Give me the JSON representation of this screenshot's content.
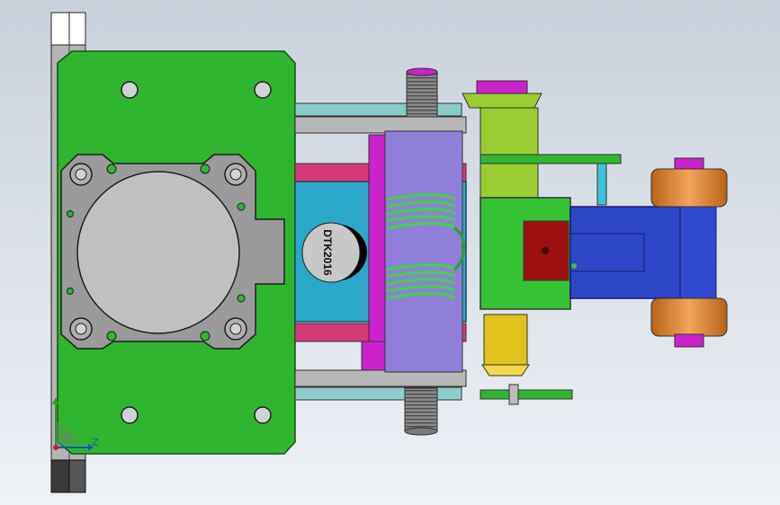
{
  "viewport": {
    "background_top": "#c9d1dc",
    "background_bottom": "#eef1f5"
  },
  "part_label": {
    "text": "DTK2016"
  },
  "triad": {
    "z_label": "Z"
  },
  "colors": {
    "base_plate": "#2fb52f",
    "base_plate_edge": "#145214",
    "cylinder_flange": "#9a9a9a",
    "cylinder_bore": "#c0c0c0",
    "guide_rail": "#b7b7b7",
    "cross_bar": "#d43a78",
    "body_block": "#2aa7c9",
    "piston_rod": "#cc22cc",
    "sleeve": "#8f7fd9",
    "spring": "#3bd83b",
    "pin_head": "#9acd32",
    "clamp_block": "#2e46c8",
    "clamp_arm": "#35c335",
    "nut_block": "#a01010",
    "roller": "#e08a3a",
    "bolt": "#8c8c8c",
    "washer": "#e0c21a"
  }
}
